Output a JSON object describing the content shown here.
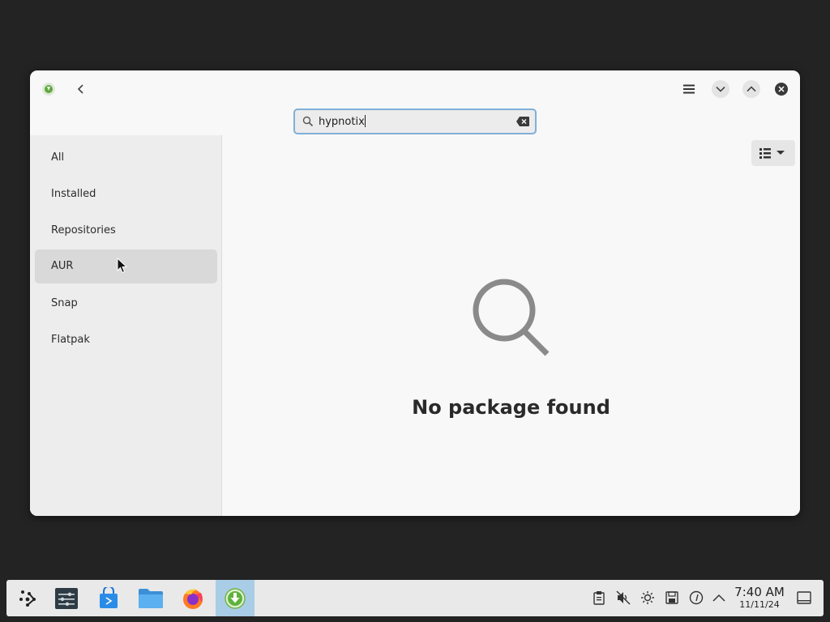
{
  "window": {
    "app_icon": "pamac-download-icon",
    "back_icon": "chevron-left-icon",
    "menu_icon": "hamburger-icon",
    "minimize_icon": "chevron-down-icon",
    "maximize_icon": "chevron-up-icon",
    "close_icon": "close-icon"
  },
  "search": {
    "value": "hypnotix",
    "icon": "search-icon",
    "clear_icon": "backspace-clear-icon"
  },
  "sidebar": {
    "items": [
      {
        "label": "All"
      },
      {
        "label": "Installed"
      },
      {
        "label": "Repositories"
      },
      {
        "label": "AUR"
      },
      {
        "label": "Snap"
      },
      {
        "label": "Flatpak"
      }
    ],
    "active_index": 3
  },
  "main": {
    "view_toggle_icon": "list-view-icon",
    "empty_icon": "magnifier-icon",
    "empty_text": "No package found"
  },
  "taskbar": {
    "apps": [
      {
        "name": "application-launcher"
      },
      {
        "name": "system-settings"
      },
      {
        "name": "discover-store"
      },
      {
        "name": "file-manager"
      },
      {
        "name": "firefox"
      },
      {
        "name": "pamac-package-manager",
        "active": true
      }
    ],
    "tray": [
      "clipboard-icon",
      "volume-muted-icon",
      "brightness-icon",
      "save-icon",
      "network-icon",
      "chevron-up-icon"
    ],
    "time": "7:40 AM",
    "date": "11/11/24"
  },
  "colors": {
    "desktop": "#232323",
    "window_bg": "#f8f8f8",
    "sidebar_bg": "#ededed",
    "active_item": "#d9d9d9",
    "focus_border": "#7fb0d8",
    "taskbar_active": "#a9cde6"
  }
}
